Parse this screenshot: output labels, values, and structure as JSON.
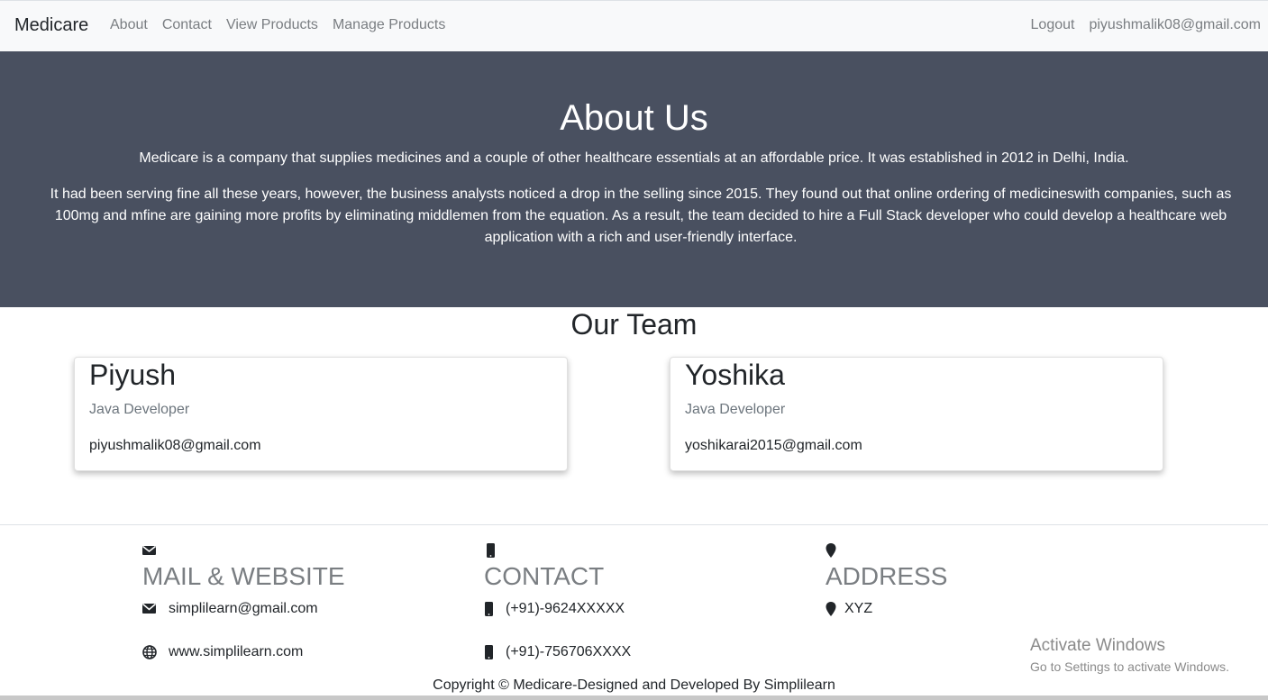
{
  "navbar": {
    "brand": "Medicare",
    "links": [
      "About",
      "Contact",
      "View Products",
      "Manage Products"
    ],
    "logout": "Logout",
    "user_email": "piyushmalik08@gmail.com"
  },
  "hero": {
    "title": "About Us",
    "paragraph1": "Medicare is a company that supplies medicines and a couple of other healthcare essentials at an affordable price. It was established in 2012 in Delhi, India.",
    "paragraph2": "It had been serving fine all these years, however, the business analysts noticed a drop in the selling since 2015. They found out that online ordering of medicineswith companies, such as 100mg and mfine are gaining more profits by eliminating middlemen from the equation. As a result, the team decided to hire a Full Stack developer who could develop a healthcare web application with a rich and user-friendly interface."
  },
  "team": {
    "title": "Our Team",
    "members": [
      {
        "name": "Piyush",
        "role": "Java Developer",
        "email": "piyushmalik08@gmail.com"
      },
      {
        "name": "Yoshika",
        "role": "Java Developer",
        "email": "yoshikarai2015@gmail.com"
      }
    ]
  },
  "footer": {
    "mail": {
      "icon": "envelope-icon",
      "heading": "MAIL & WEBSITE",
      "email": "simplilearn@gmail.com",
      "website": "www.simplilearn.com"
    },
    "contact": {
      "icon": "mobile-icon",
      "heading": "CONTACT",
      "phone1": "(+91)-9624XXXXX",
      "phone2": "(+91)-756706XXXX"
    },
    "address": {
      "icon": "map-marker-icon",
      "heading": "ADDRESS",
      "value": "XYZ"
    },
    "copyright": "Copyright © Medicare-Designed and Developed By Simplilearn"
  },
  "watermark": {
    "line1": "Activate Windows",
    "line2": "Go to Settings to activate Windows."
  },
  "colors": {
    "hero_bg": "#495060",
    "navbar_bg": "#f8f9fa",
    "muted_text": "#7a7e82"
  }
}
